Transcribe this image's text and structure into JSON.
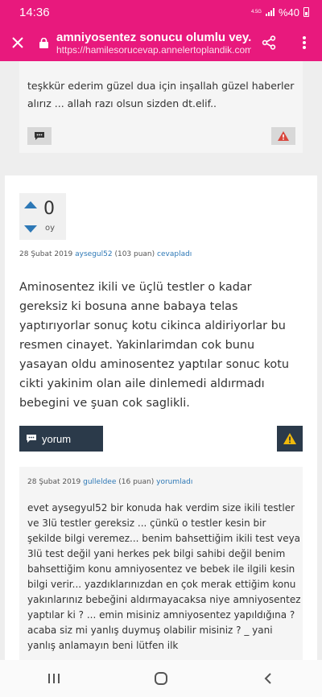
{
  "status_bar": {
    "time": "14:36",
    "network": "4.5G",
    "battery": "%40"
  },
  "browser": {
    "title": "amniyosentez sonucu olumlu vey...",
    "url": "https://hamilesorucevap.annelertoplandik.com..."
  },
  "prev_comment": {
    "text": "teşkkür ederim güzel dua için inşallah güzel haberler alırız ... allah razı olsun sizden dt.elif.."
  },
  "answer": {
    "votes": "0",
    "vote_label": "oy",
    "date": "28 Şubat 2019",
    "user": "aysegul52",
    "points": "(103 puan)",
    "action": "cevapladı",
    "body": "Aminosentez ikili ve üçlü testler o kadar gereksiz ki bosuna anne babaya telas yaptırıyorlar sonuç kotu cikinca aldiriyorlar bu resmen cinayet. Yakinlarimdan cok bunu yasayan oldu aminosentez yaptılar sonuc kotu cikti yakinim olan aile dinlemedi aldırmadı bebegini ve şuan cok saglikli.",
    "comment_button": "yorum"
  },
  "reply": {
    "date": "28 Şubat 2019",
    "user": "gulleldee",
    "points": "(16 puan)",
    "action": "yorumladı",
    "body": "evet aysegyul52  bir konuda hak verdim size ikili testler ve 3lü testler gereksiz ... çünkü o testler kesin bir şekilde bilgi veremez... benim bahsettiğim ikili test veya 3lü test değil yani  herkes pek bilgi sahibi değil benim bahsettiğim konu amniyosentez ve bebek ile ilgili kesin bilgi verir... yazdıklarınızdan en çok merak ettiğim konu yakınlarınız bebeğini aldırmayacaksa niye amniyosentez yaptılar ki ?  ... emin misiniz amniyosentez yapıldığına ? acaba siz mi yanlış duymuş olabilir misiniz ? _ yani yanlış anlamayın beni lütfen ilk"
  },
  "colors": {
    "brand": "#e8197d",
    "link": "#2d78b6",
    "button_dark": "#2b3a4a",
    "warning": "#f0b90b",
    "report_red": "#d9463c"
  }
}
